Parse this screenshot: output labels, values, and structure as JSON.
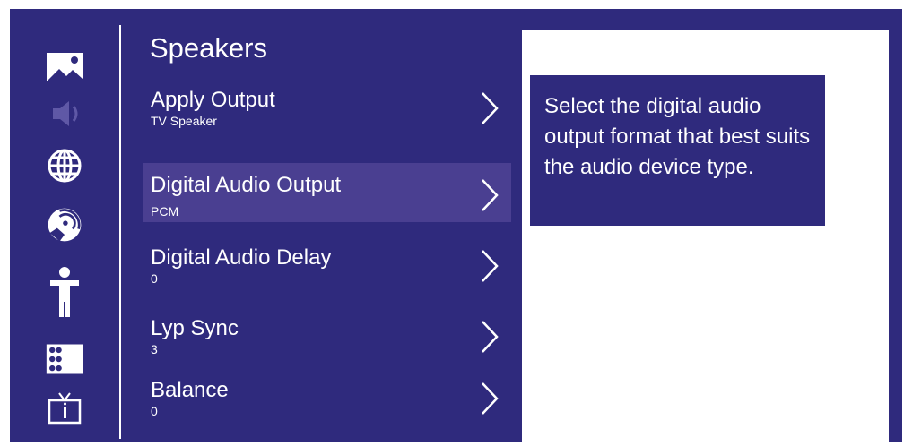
{
  "menu": {
    "title": "Speakers",
    "items": [
      {
        "label": "Apply Output",
        "value": "TV Speaker",
        "selected": false
      },
      {
        "label": "Digital Audio Output",
        "value": "PCM",
        "selected": true
      },
      {
        "label": "Digital Audio Delay",
        "value": "0",
        "selected": false
      },
      {
        "label": "Lyp Sync",
        "value": "3",
        "selected": false
      },
      {
        "label": "Balance",
        "value": "0",
        "selected": false
      }
    ]
  },
  "help": {
    "text": "Select the digital audio output format that best suits the audio device type."
  },
  "sidebar": {
    "icons": [
      "picture-icon",
      "sound-icon",
      "globe-icon",
      "satellite-dish-icon",
      "accessibility-icon",
      "keypad-icon",
      "tv-info-icon"
    ],
    "active": "sound-icon"
  },
  "colors": {
    "panel": "#2f2a7d",
    "selected_row": "#4a3f91",
    "text": "#ffffff",
    "inactive_icon": "#5f58a6"
  }
}
